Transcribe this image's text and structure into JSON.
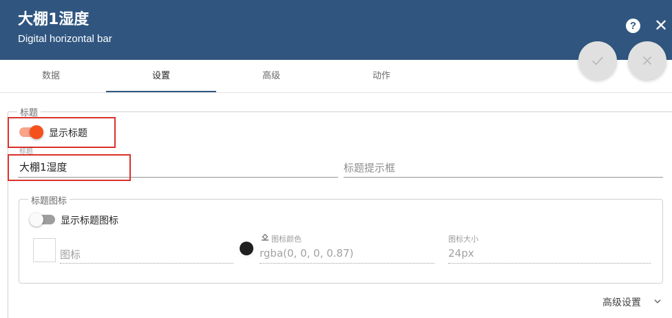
{
  "header": {
    "title": "大棚1湿度",
    "subtitle": "Digital horizontal bar",
    "help_icon": "help-circle-icon",
    "close_icon": "close-icon",
    "background": "#305680"
  },
  "actions": {
    "confirm_icon": "check-icon",
    "cancel_icon": "close-icon"
  },
  "tabs": [
    {
      "label": "数据",
      "active": false
    },
    {
      "label": "设置",
      "active": true
    },
    {
      "label": "高级",
      "active": false
    },
    {
      "label": "动作",
      "active": false
    }
  ],
  "title_section": {
    "legend": "标题",
    "show_title": {
      "label": "显示标题",
      "checked": true,
      "color": "#f4511e"
    },
    "title_field": {
      "label": "标题",
      "value": "大棚1湿度"
    },
    "tooltip_field": {
      "placeholder": "标题提示框"
    }
  },
  "title_icon_section": {
    "legend": "标题图标",
    "show_icon": {
      "label": "显示标题图标",
      "checked": false
    },
    "icon_field": {
      "label": "图标"
    },
    "icon_color": {
      "label": "图标颜色",
      "value": "rgba(0, 0, 0, 0.87)",
      "swatch": "#1f1f1f"
    },
    "icon_size": {
      "label": "图标大小",
      "value": "24px"
    }
  },
  "advanced": {
    "label": "高级设置",
    "icon": "chevron-down-icon"
  }
}
